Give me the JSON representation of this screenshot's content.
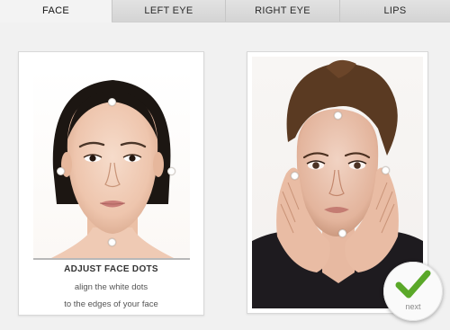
{
  "tabs": [
    {
      "label": "FACE",
      "active": true
    },
    {
      "label": "LEFT EYE",
      "active": false
    },
    {
      "label": "RIGHT EYE",
      "active": false
    },
    {
      "label": "LIPS",
      "active": false
    }
  ],
  "instructions": {
    "title": "ADJUST FACE DOTS",
    "line1": "align the white dots",
    "line2": "to the edges of your face"
  },
  "next_button": {
    "label": "next",
    "icon": "checkmark-icon",
    "icon_color": "#5aa829"
  },
  "colors": {
    "tab_bar": "#dcdcdc",
    "active_tab": "#f3f3f3",
    "dot": "#ffffff"
  }
}
